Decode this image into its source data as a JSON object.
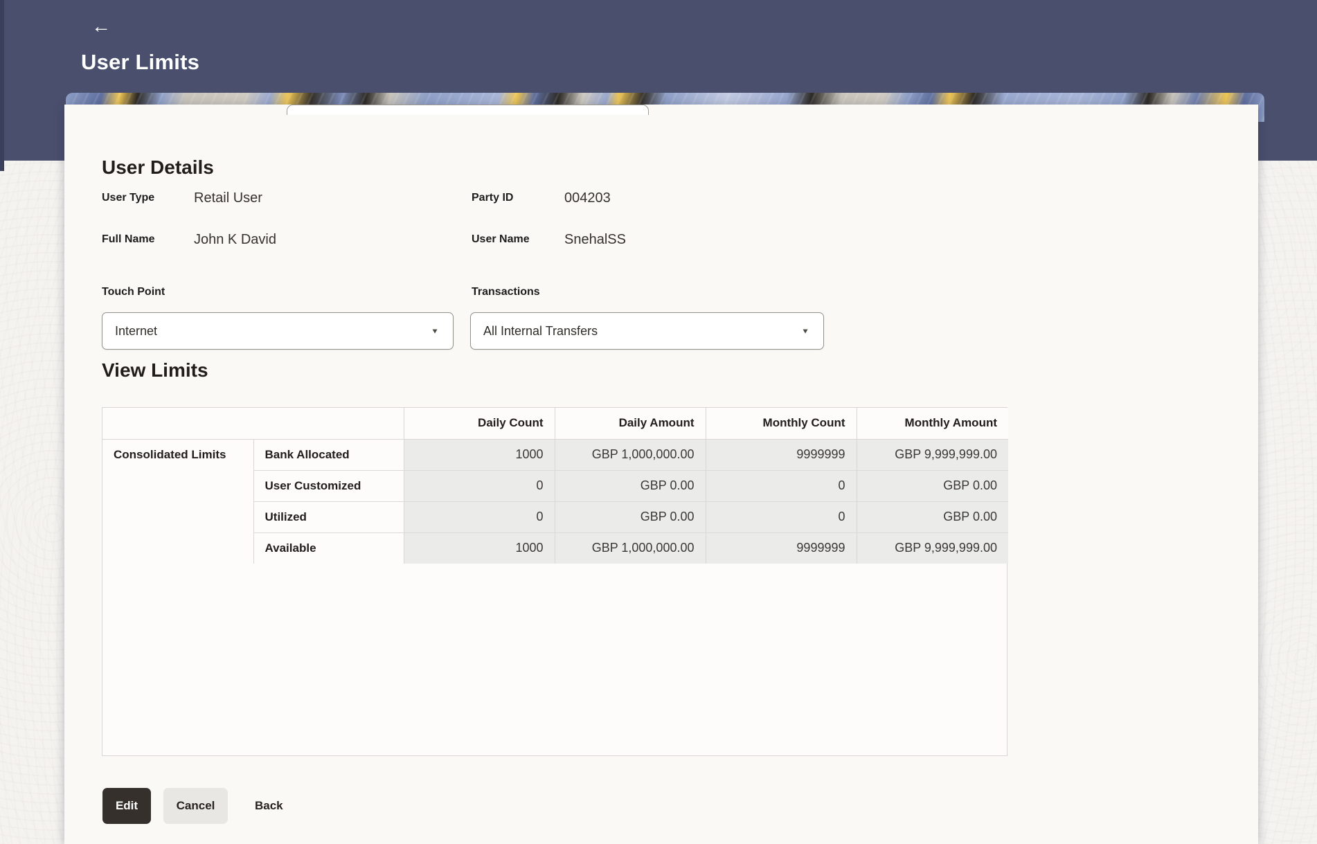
{
  "header": {
    "title": "User Limits"
  },
  "icons": {
    "back": "←",
    "caret": "▼"
  },
  "user_details": {
    "section_title": "User Details",
    "fields": [
      {
        "label": "User Type",
        "value": "Retail User"
      },
      {
        "label": "Party ID",
        "value": "004203"
      },
      {
        "label": "Full Name",
        "value": "John K David"
      },
      {
        "label": "User Name",
        "value": "SnehalSS"
      }
    ]
  },
  "filters": {
    "touch_point": {
      "label": "Touch Point",
      "value": "Internet"
    },
    "transactions": {
      "label": "Transactions",
      "value": "All Internal Transfers"
    }
  },
  "view_limits": {
    "section_title": "View Limits",
    "table": {
      "group_label": "Consolidated Limits",
      "columns": [
        "Daily Count",
        "Daily Amount",
        "Monthly Count",
        "Monthly Amount"
      ],
      "rows": [
        {
          "label": "Bank Allocated",
          "daily_count": "1000",
          "daily_amount": "GBP 1,000,000.00",
          "monthly_count": "9999999",
          "monthly_amount": "GBP 9,999,999.00"
        },
        {
          "label": "User Customized",
          "daily_count": "0",
          "daily_amount": "GBP 0.00",
          "monthly_count": "0",
          "monthly_amount": "GBP 0.00"
        },
        {
          "label": "Utilized",
          "daily_count": "0",
          "daily_amount": "GBP 0.00",
          "monthly_count": "0",
          "monthly_amount": "GBP 0.00"
        },
        {
          "label": "Available",
          "daily_count": "1000",
          "daily_amount": "GBP 1,000,000.00",
          "monthly_count": "9999999",
          "monthly_amount": "GBP 9,999,999.00"
        }
      ]
    }
  },
  "actions": {
    "edit": "Edit",
    "cancel": "Cancel",
    "back": "Back"
  },
  "colors": {
    "header-bg": "#4A4F6D",
    "page-bg": "#F5F3F0",
    "card-bg": "#FAF9F6",
    "cell-bg": "#EBEBEA",
    "edit-bg": "#35302B",
    "cancel-bg": "#E9E7E4",
    "banner-yellow": "#EFC654",
    "banner-blue": "#8FA0C8",
    "banner-dark": "#2D2A26"
  }
}
